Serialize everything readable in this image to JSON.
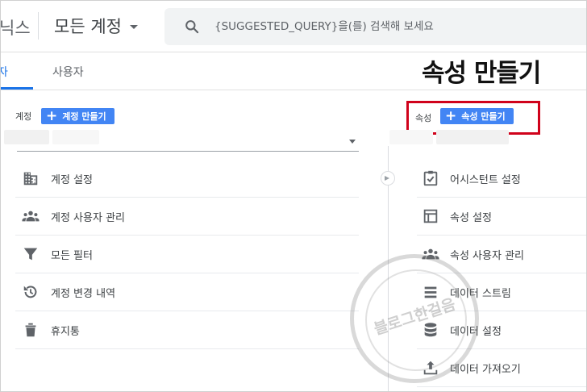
{
  "header": {
    "brand_fragment": "닉스",
    "account_selector": "모든 계정",
    "search_placeholder": "{SUGGESTED_QUERY}을(를) 검색해 보세요"
  },
  "tabs": {
    "active_fragment": "자",
    "users": "사용자"
  },
  "overlay_title": "속성 만들기",
  "account_section": {
    "label": "계정",
    "create_label": "계정 만들기",
    "items": [
      {
        "label": "계정 설정",
        "icon": "building-icon"
      },
      {
        "label": "계정 사용자 관리",
        "icon": "people-icon"
      },
      {
        "label": "모든 필터",
        "icon": "filter-icon"
      },
      {
        "label": "계정 변경 내역",
        "icon": "history-icon"
      },
      {
        "label": "휴지통",
        "icon": "trash-icon"
      }
    ]
  },
  "property_section": {
    "label": "속성",
    "create_label": "속성 만들기",
    "items": [
      {
        "label": "어시스턴트 설정",
        "icon": "checklist-icon"
      },
      {
        "label": "속성 설정",
        "icon": "layout-icon"
      },
      {
        "label": "속성 사용자 관리",
        "icon": "people-icon"
      },
      {
        "label": "데이터 스트림",
        "icon": "streams-icon"
      },
      {
        "label": "데이터 설정",
        "icon": "database-icon"
      },
      {
        "label": "데이터 가져오기",
        "icon": "upload-icon"
      }
    ]
  },
  "watermark": "블로그한걸음",
  "colors": {
    "accent": "#1a73e8",
    "button": "#4285f4",
    "highlight": "#d0021b"
  }
}
